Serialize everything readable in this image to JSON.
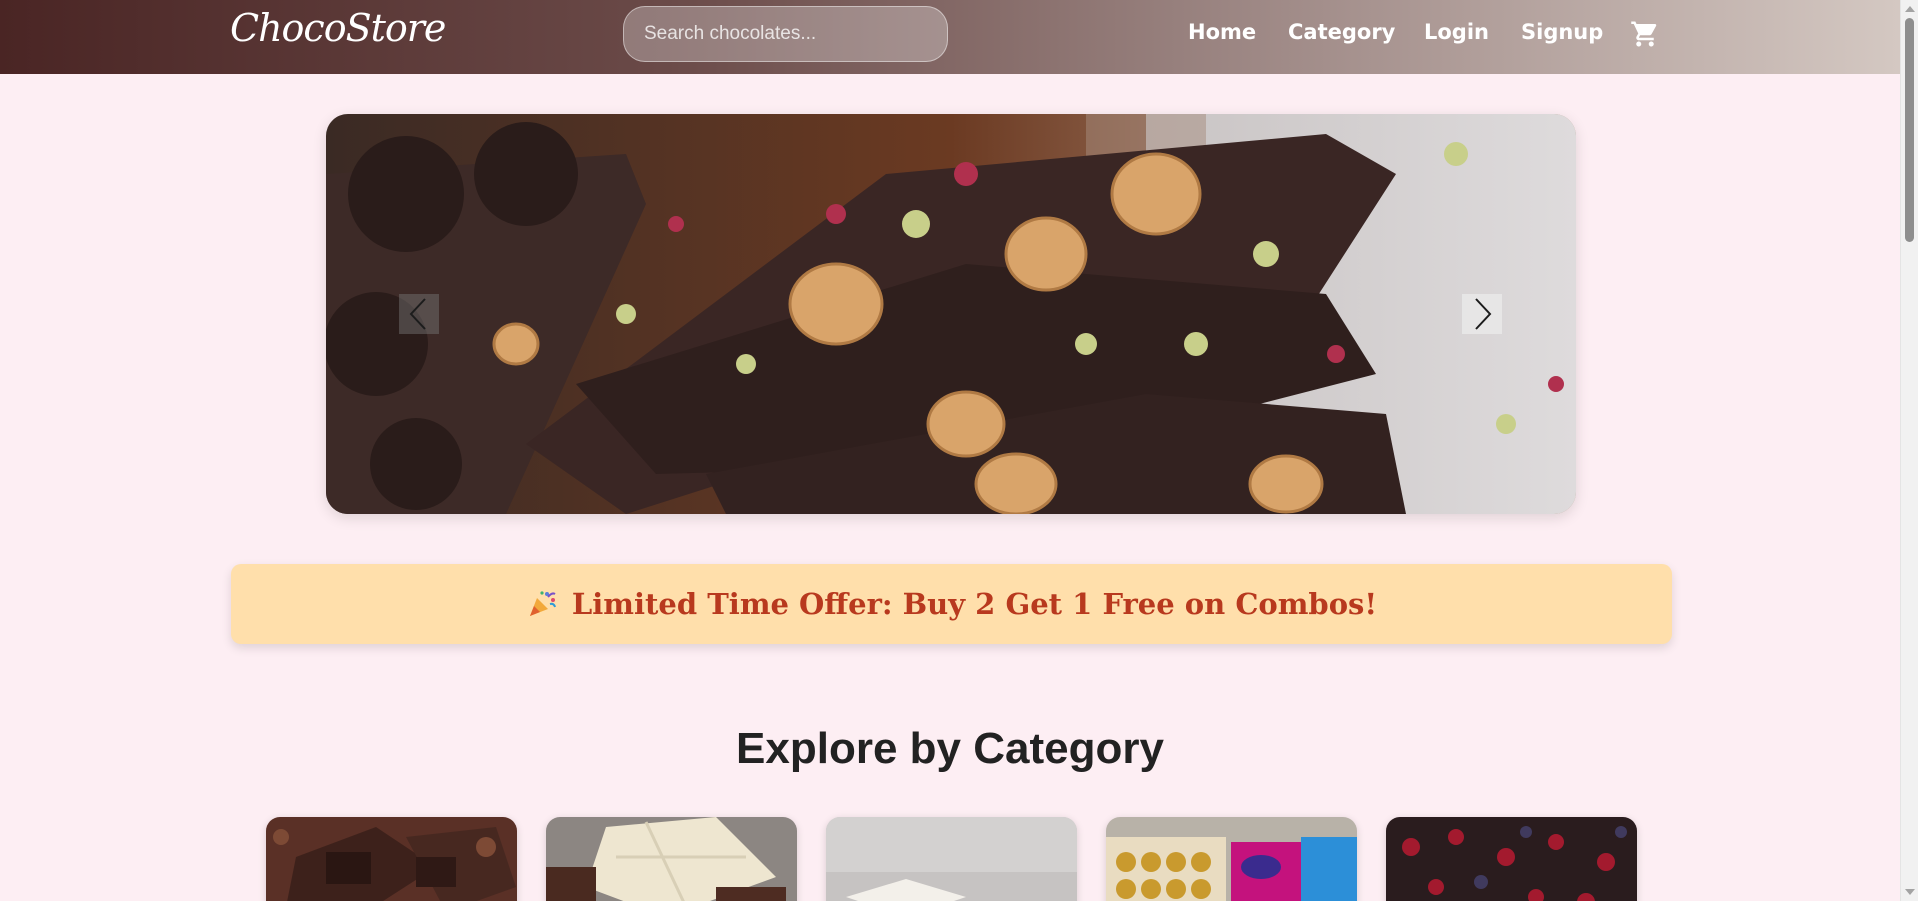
{
  "brand": {
    "name": "ChocoStore"
  },
  "search": {
    "placeholder": "Search chocolates..."
  },
  "nav": {
    "links": [
      "Home",
      "Category",
      "Login",
      "Signup"
    ]
  },
  "carousel": {
    "prev_icon": "chevron-left-icon",
    "next_icon": "chevron-right-icon"
  },
  "offer": {
    "icon": "party-popper-icon",
    "text": "Limited Time Offer: Buy 2 Get 1 Free on Combos!"
  },
  "categories_section": {
    "title": "Explore by Category"
  },
  "colors": {
    "page_bg": "#fdeef3",
    "offer_bg": "#ffdfab",
    "offer_text": "#b8391e"
  }
}
